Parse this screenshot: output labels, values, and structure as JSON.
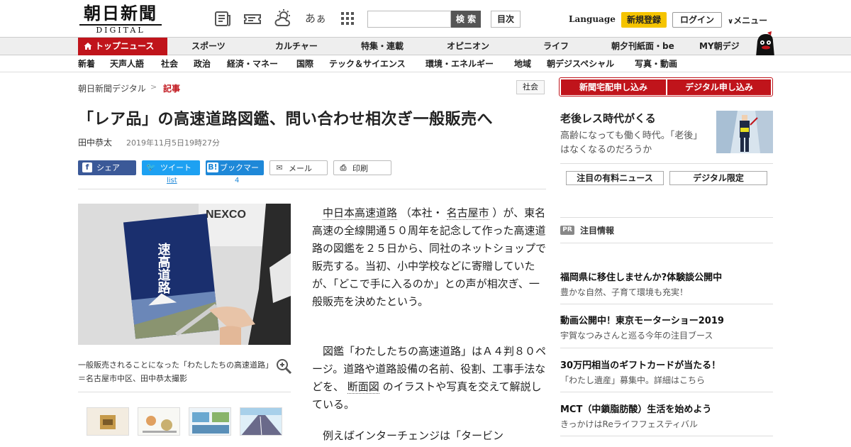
{
  "header": {
    "logo_jp": "朝日新聞",
    "logo_en": "DIGITAL",
    "search_button": "検 索",
    "index_button": "目次",
    "language": "Language",
    "register": "新規登録",
    "login": "ログイン",
    "menu": "メニュー",
    "kana_icon": "あぁ",
    "icons": [
      "newspaper-icon",
      "ticket-icon",
      "weather-icon",
      "kana-size-icon",
      "grid-icon"
    ]
  },
  "nav_primary": {
    "top": "トップニュース",
    "items": [
      "スポーツ",
      "カルチャー",
      "特集・連載",
      "オピニオン",
      "ライフ",
      "朝夕刊紙面・be",
      "MY朝デジ"
    ]
  },
  "nav_secondary": {
    "items": [
      "新着",
      "天声人語",
      "社会",
      "政治",
      "経済・マネー",
      "国際",
      "テック＆サイエンス",
      "環境・エネルギー",
      "地域",
      "朝デジスペシャル",
      "写真・動画"
    ]
  },
  "breadcrumb": {
    "home": "朝日新聞デジタル",
    "sep": ">",
    "current": "記事",
    "category": "社会"
  },
  "article": {
    "title": "「レア品」の高速道路図鑑、問い合わせ相次ぎ一般販売へ",
    "author": "田中恭太",
    "date": "2019年11月5日19時27分",
    "share": {
      "facebook": "シェア",
      "twitter": "ツイート",
      "twitter_sub": "list",
      "hatena": "ブックマーク",
      "hatena_count": "4",
      "mail": "メール",
      "print": "印刷"
    },
    "photo_caption": "一般販売されることになった「わたしたちの高速道路」＝名古屋市中区、田中恭太撮影",
    "book_title": "速高道路",
    "p1": {
      "link1": "中日本高速道路",
      "t1": "（本社・",
      "link2": "名古屋市",
      "t2": "）が、東名高速の全線開通５０周年を記念して作った高速道路の図鑑を２５日から、同社のネットショップで販売する。当初、小中学校などに寄贈していたが、「どこで手に入るのか」との声が相次ぎ、一般販売を決めたという。"
    },
    "p2": {
      "t1": "図鑑「わたしたちの高速道路」はＡ４判８０ページ。道路や道路設備の名前、役割、工事手法などを、",
      "link": "断面図",
      "t2": "のイラストや写真を交えて解説している。"
    },
    "p3": "例えばインターチェンジは「タービン"
  },
  "sidebar": {
    "btn_home": "新聞宅配申し込み",
    "btn_digital": "デジタル申し込み",
    "promo_title": "老後レス時代がくる",
    "promo_desc": "高齢になっても働く時代。「老後」はなくなるのだろうか",
    "btn_paid": "注目の有料ニュース",
    "btn_limited": "デジタル限定",
    "pr_tag": "PR",
    "pr_label": "注目情報",
    "ads": [
      {
        "title": "福岡県に移住しませんか?体験談公開中",
        "desc": "豊かな自然、子育て環境も充実！"
      },
      {
        "title": "動画公開中！東京モーターショー2019",
        "desc": "宇賀なつみさんと巡る今年の注目ブース"
      },
      {
        "title": "30万円相当のギフトカードが当たる！",
        "desc": "「わたし遺産」募集中。詳細はこちら"
      },
      {
        "title": "MCT（中鎖脂肪酸）生活を始めよう",
        "desc": "きっかけはReライフフェスティバル"
      }
    ]
  },
  "colors": {
    "brand_red": "#c0141b",
    "facebook": "#3b5998",
    "twitter": "#1da1f2",
    "hatena": "#1e88d8",
    "register": "#f5c400"
  }
}
